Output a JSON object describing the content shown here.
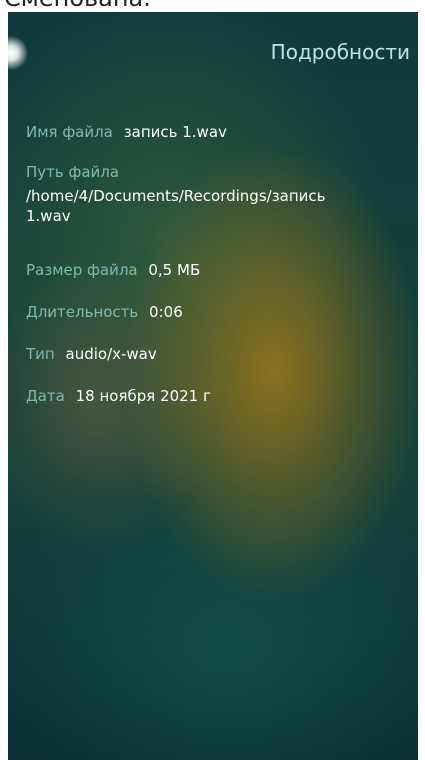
{
  "top_cut_text": "Сменована.",
  "header": {
    "title": "Подробности"
  },
  "details": [
    {
      "label": "Имя файла",
      "value": "запись 1.wav"
    },
    {
      "label": "Путь файла",
      "value_line1": "/home/4/Documents/Recordings/запись",
      "value_line2": "1.wav"
    },
    {
      "label": "Размер файла",
      "value": "0,5 МБ"
    },
    {
      "label": "Длительность",
      "value": "0:06"
    },
    {
      "label": "Тип",
      "value": "audio/x-wav"
    },
    {
      "label": "Дата",
      "value": "18 ноября 2021 г"
    }
  ],
  "colors": {
    "label": "#7fb9b0",
    "value": "#ffffff",
    "title": "#b8e6e2",
    "background": "#0e3a3d"
  }
}
